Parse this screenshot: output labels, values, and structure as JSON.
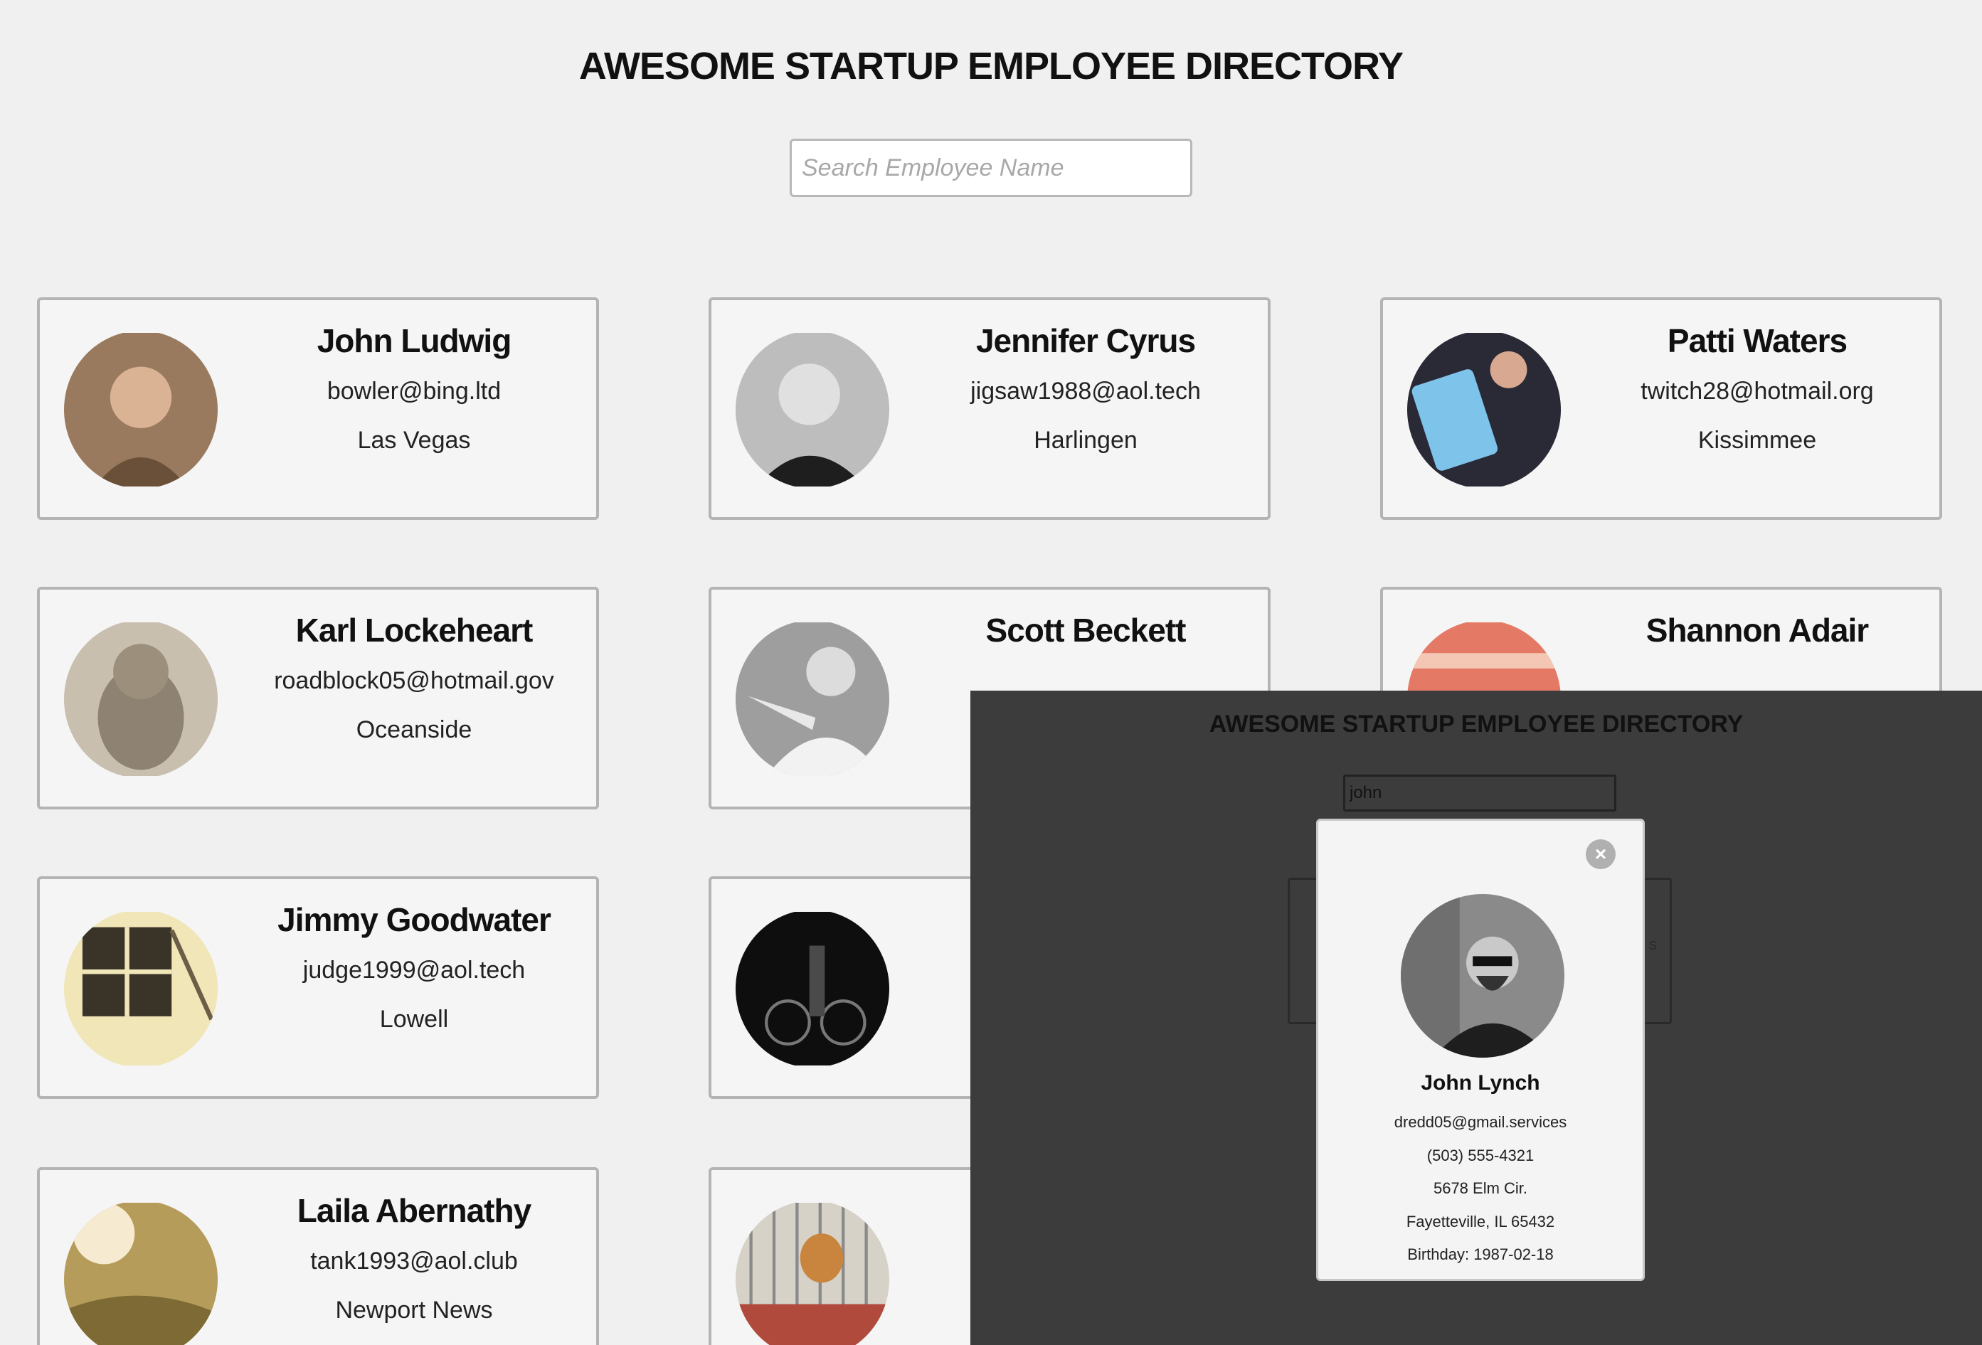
{
  "header": {
    "title": "AWESOME STARTUP EMPLOYEE DIRECTORY",
    "search_placeholder": "Search Employee Name"
  },
  "employees": [
    {
      "name": "John Ludwig",
      "email": "bowler@bing.ltd",
      "city": "Las Vegas"
    },
    {
      "name": "Jennifer Cyrus",
      "email": "jigsaw1988@aol.tech",
      "city": "Harlingen"
    },
    {
      "name": "Patti Waters",
      "email": "twitch28@hotmail.org",
      "city": "Kissimmee"
    },
    {
      "name": "Karl Lockeheart",
      "email": "roadblock05@hotmail.gov",
      "city": "Oceanside"
    },
    {
      "name": "Scott Beckett",
      "email": "",
      "city": ""
    },
    {
      "name": "Shannon Adair",
      "email": "",
      "city": ""
    },
    {
      "name": "Jimmy Goodwater",
      "email": "judge1999@aol.tech",
      "city": "Lowell"
    },
    {
      "name": "",
      "email": "",
      "city": ""
    },
    {
      "name": "Laila Abernathy",
      "email": "tank1993@aol.club",
      "city": "Newport News"
    },
    {
      "name": "",
      "email": "",
      "city": ""
    }
  ],
  "overlay": {
    "title": "AWESOME STARTUP EMPLOYEE DIRECTORY",
    "search_value": "john",
    "modal": {
      "close_icon": "close-circle-icon",
      "name": "John Lynch",
      "email": "dredd05@gmail.services",
      "phone": "(503) 555-4321",
      "street": "5678 Elm Cir.",
      "city_state_zip": "Fayetteville, IL 65432",
      "birthday": "Birthday: 1987-02-18"
    }
  }
}
